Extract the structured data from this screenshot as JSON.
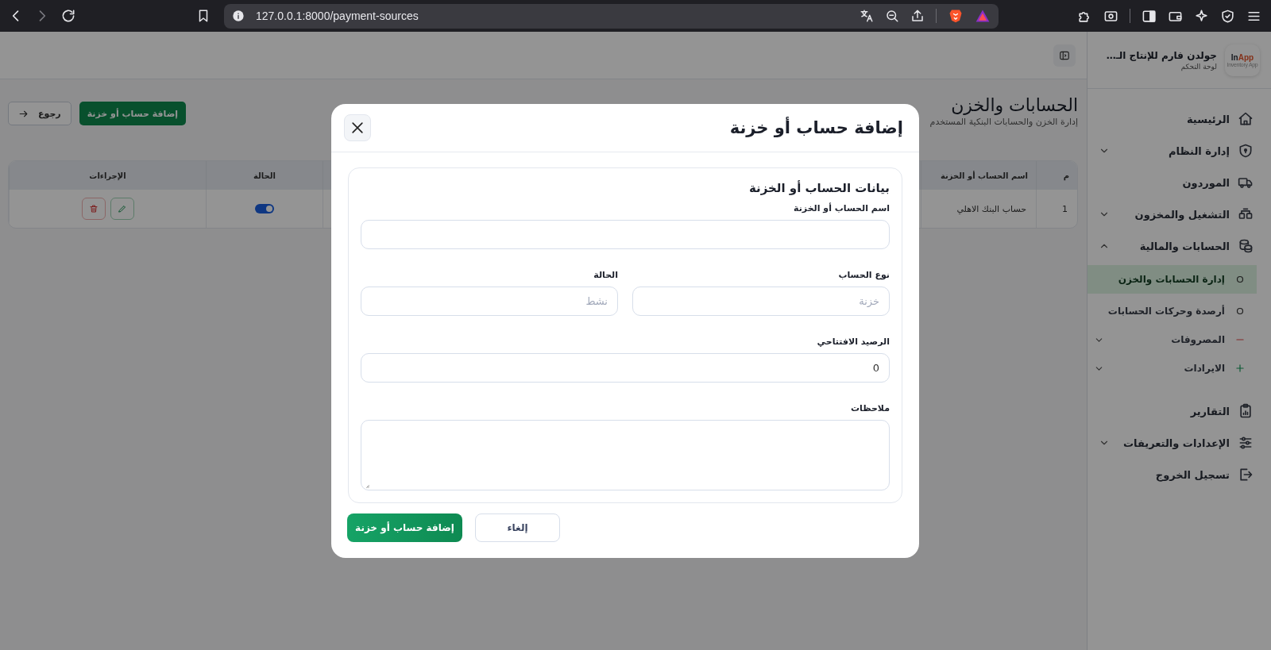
{
  "browser": {
    "url": "127.0.0.1:8000/payment-sources"
  },
  "sidebar": {
    "brand": {
      "logo_primary": "In",
      "logo_accent": "App",
      "logo_caption": "Inventory App",
      "name": "جولدن فارم للإنتاج الـ…",
      "subtitle": "لوحة التحكم"
    },
    "items": [
      {
        "label": "الرئيسية",
        "selected": false
      },
      {
        "label": "إدارة النظام",
        "selected": false,
        "expanded": false
      },
      {
        "label": "الموردون",
        "selected": false
      },
      {
        "label": "التشغيل والمخزون",
        "selected": false,
        "expanded": false
      },
      {
        "label": "الحسابات والمالية",
        "selected": false,
        "expanded": true,
        "children": [
          {
            "label": "إدارة الحسابات والخزن",
            "selected": true
          },
          {
            "label": "أرصدة وحركات الحسابات",
            "selected": false
          },
          {
            "label": "المصروفات",
            "selected": false,
            "expanded": false
          },
          {
            "label": "الايرادات",
            "selected": false,
            "expanded": false
          }
        ]
      },
      {
        "label": "التقارير",
        "selected": false
      },
      {
        "label": "الإعدادات والتعريفات",
        "selected": false,
        "expanded": false
      },
      {
        "label": "تسجيل الخروج",
        "selected": false
      }
    ]
  },
  "page": {
    "title": "الحسابات والخزن",
    "subtitle": "إدارة الخزن والحسابات البنكية المستخدم",
    "add_button": "إضافة حساب أو خزنة",
    "back_button": "رجوع"
  },
  "table": {
    "columns": [
      "م",
      "اسم الحساب أو الخزنة",
      "الحالة",
      "الإجراءات"
    ],
    "rows": [
      {
        "number": "1",
        "name": "حساب البنك الاهلي",
        "active": true
      }
    ]
  },
  "modal": {
    "title": "إضافة حساب أو خزنة",
    "section_title": "بيانات الحساب أو الخزنة",
    "rows": [
      [
        {
          "kind": "input",
          "label": "اسم الحساب أو الخزنة"
        }
      ],
      [
        {
          "kind": "input",
          "label": "نوع الحساب",
          "placeholder": "خزنة"
        },
        {
          "kind": "input",
          "label": "الحالة",
          "placeholder": "نشط"
        }
      ],
      [
        {
          "kind": "input",
          "label": "الرصيد الافتتاحي",
          "value": "0"
        }
      ],
      [
        {
          "kind": "textarea",
          "label": "ملاحظات"
        }
      ]
    ],
    "submit_button": "إضافة حساب أو خزنة",
    "cancel_button": "إلغاء"
  }
}
